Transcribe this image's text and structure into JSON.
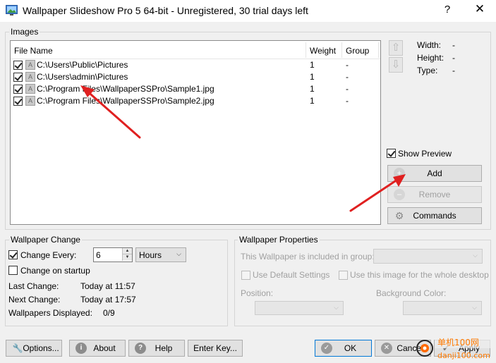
{
  "window": {
    "title": "Wallpaper Slideshow Pro 5 64-bit - Unregistered, 30 trial days left",
    "help": "?",
    "close": "✕"
  },
  "images": {
    "group_label": "Images",
    "columns": [
      "File Name",
      "Weight",
      "Group"
    ],
    "rows": [
      {
        "file": "C:\\Users\\Public\\Pictures",
        "weight": "1",
        "group": "-",
        "checked": true
      },
      {
        "file": "C:\\Users\\admin\\Pictures",
        "weight": "1",
        "group": "-",
        "checked": true
      },
      {
        "file": "C:\\Program Files\\WallpaperSSPro\\Sample1.jpg",
        "weight": "1",
        "group": "-",
        "checked": true
      },
      {
        "file": "C:\\Program Files\\WallpaperSSPro\\Sample2.jpg",
        "weight": "1",
        "group": "-",
        "checked": true
      }
    ],
    "info": {
      "width_label": "Width:",
      "width_value": "-",
      "height_label": "Height:",
      "height_value": "-",
      "type_label": "Type:",
      "type_value": "-"
    },
    "show_preview_label": "Show Preview",
    "add_label": "Add",
    "remove_label": "Remove",
    "commands_label": "Commands"
  },
  "wallpaper_change": {
    "group_label": "Wallpaper Change",
    "change_every_label": "Change Every:",
    "change_every_value": "6",
    "unit_value": "Hours",
    "change_on_startup_label": "Change on startup",
    "last_change_label": "Last Change:",
    "last_change_value": "Today at 11:57",
    "next_change_label": "Next Change:",
    "next_change_value": "Today at 17:57",
    "displayed_label": "Wallpapers Displayed:",
    "displayed_value": "0/9"
  },
  "wallpaper_properties": {
    "group_label": "Wallpaper Properties",
    "included_label": "This Wallpaper is included in group:",
    "use_default_label": "Use Default Settings",
    "whole_desktop_label": "Use this image for the whole desktop",
    "position_label": "Position:",
    "background_color_label": "Background Color:"
  },
  "footer": {
    "options_label": "Options...",
    "about_label": "About",
    "help_label": "Help",
    "enter_key_label": "Enter Key...",
    "ok_label": "OK",
    "cancel_label": "Cancel",
    "apply_label": "Apply"
  },
  "colors": {
    "annotation_arrow": "#e02020",
    "window_bg": "#f0f0f0",
    "focus_border": "#0078d7"
  }
}
